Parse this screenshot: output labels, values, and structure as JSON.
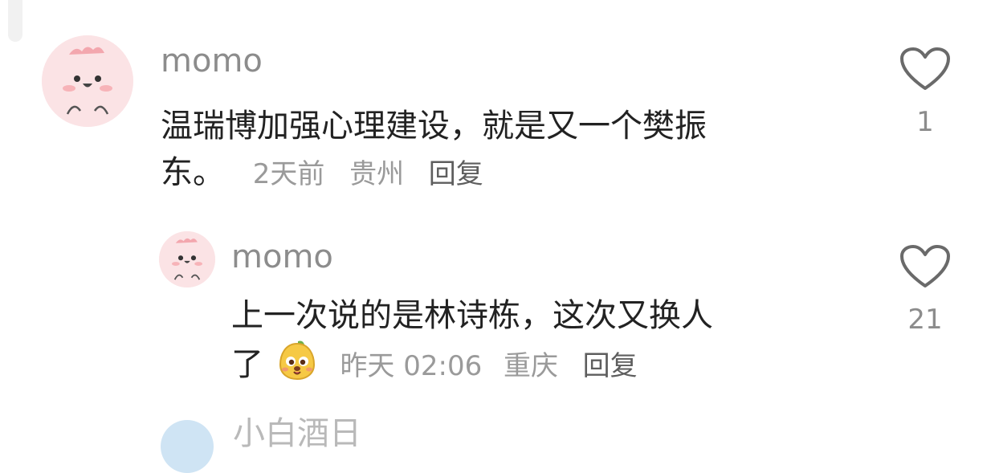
{
  "comments": [
    {
      "username": "momo",
      "text_line1": "温瑞博加强心理建设，就是又一个樊振",
      "text_line2": "东。",
      "time": "2天前",
      "location": "贵州",
      "reply_label": "回复",
      "like_count": "1"
    },
    {
      "username": "momo",
      "text_line1": "上一次说的是林诗栋，这次又换人",
      "text_line2": "了",
      "time": "昨天 02:06",
      "location": "重庆",
      "reply_label": "回复",
      "like_count": "21",
      "emoji": "mango-face-emoji"
    }
  ],
  "next_comment": {
    "username": "小白酒日"
  },
  "colors": {
    "text": "#222222",
    "username": "#8c8c8c",
    "meta": "#9a9a9a",
    "avatar_bg": "#fbe3e5"
  }
}
